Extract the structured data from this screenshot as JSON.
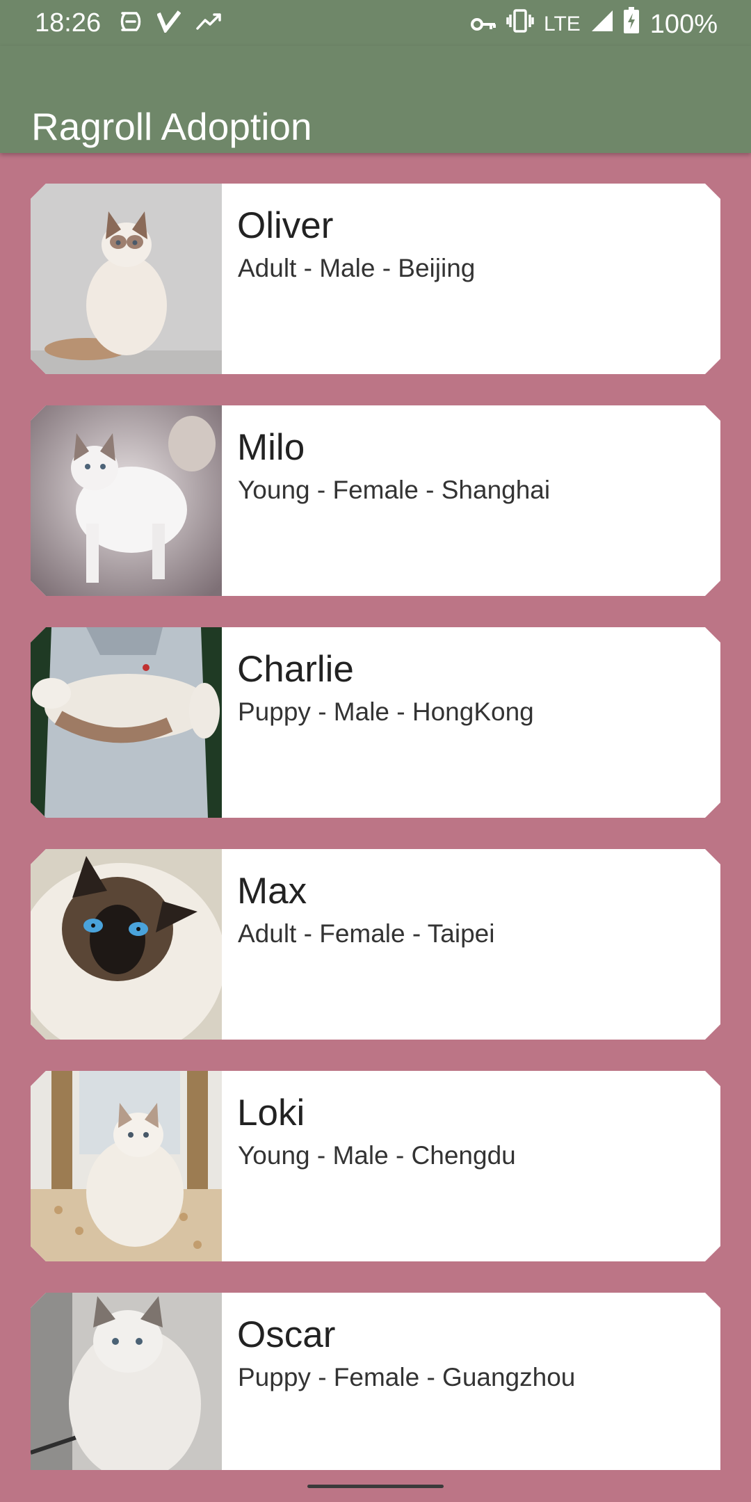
{
  "status_bar": {
    "time": "18:26",
    "left_icons": [
      "data-saver-icon",
      "check-v-icon",
      "trending-icon"
    ],
    "right_icons": [
      "vpn-key-icon",
      "vibrate-icon",
      "signal-icon",
      "battery-charging-icon"
    ],
    "network": "LTE",
    "battery": "100%"
  },
  "app_bar": {
    "title": "Ragroll Adoption",
    "color": "#6F8769"
  },
  "theme": {
    "background": "#BC7586",
    "card": "#FFFFFF"
  },
  "cats": [
    {
      "name": "Oliver",
      "details": "Adult - Male - Beijing"
    },
    {
      "name": "Milo",
      "details": "Young - Female - Shanghai"
    },
    {
      "name": "Charlie",
      "details": "Puppy - Male - HongKong"
    },
    {
      "name": "Max",
      "details": "Adult - Female - Taipei"
    },
    {
      "name": "Loki",
      "details": "Young - Male - Chengdu"
    },
    {
      "name": "Oscar",
      "details": "Puppy - Female - Guangzhou"
    }
  ]
}
